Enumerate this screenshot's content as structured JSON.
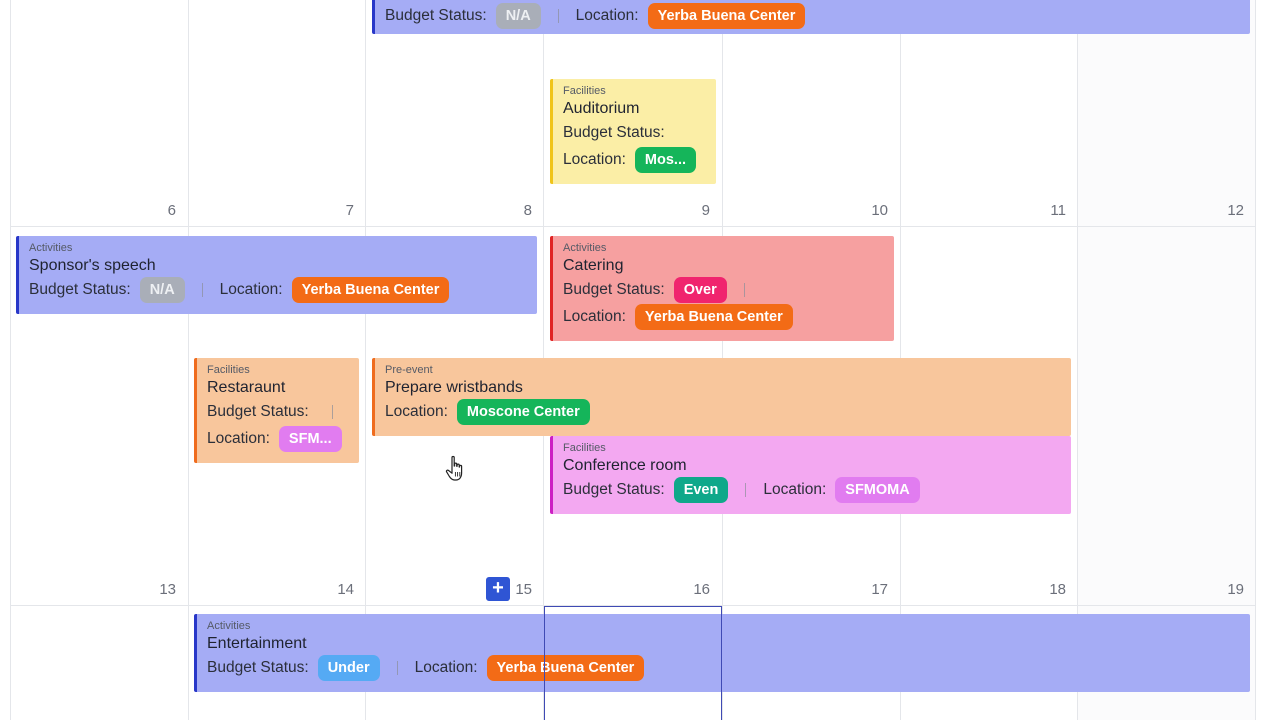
{
  "days": {
    "week1": [
      "6",
      "7",
      "8",
      "9",
      "10",
      "11",
      "12"
    ],
    "week2": [
      "13",
      "14",
      "15",
      "16",
      "17",
      "18",
      "19"
    ]
  },
  "events": {
    "top_bar": {
      "budget_label": "Budget Status:",
      "budget": "N/A",
      "location_label": "Location:",
      "location": "Yerba Buena Center"
    },
    "auditorium": {
      "category": "Facilities",
      "title": "Auditorium",
      "budget_label": "Budget Status:",
      "location_label": "Location:",
      "location": "Mos..."
    },
    "sponsor": {
      "category": "Activities",
      "title": "Sponsor's speech",
      "budget_label": "Budget Status:",
      "budget": "N/A",
      "location_label": "Location:",
      "location": "Yerba Buena Center"
    },
    "catering": {
      "category": "Activities",
      "title": "Catering",
      "budget_label": "Budget Status:",
      "budget": "Over",
      "location_label": "Location:",
      "location": "Yerba Buena Center"
    },
    "restaurant": {
      "category": "Facilities",
      "title": "Restaraunt",
      "budget_label": "Budget Status:",
      "location_label": "Location:",
      "location": "SFM..."
    },
    "wristbands": {
      "category": "Pre-event",
      "title": "Prepare wristbands",
      "location_label": "Location:",
      "location": "Moscone Center"
    },
    "conference": {
      "category": "Facilities",
      "title": "Conference room",
      "budget_label": "Budget Status:",
      "budget": "Even",
      "location_label": "Location:",
      "location": "SFMOMA"
    },
    "entertainment": {
      "category": "Activities",
      "title": "Entertainment",
      "budget_label": "Budget Status:",
      "budget": "Under",
      "location_label": "Location:",
      "location": "Yerba Buena Center"
    }
  },
  "add_button_label": "+",
  "colors": {
    "activities": "#a5acf5",
    "facilities_yellow": "#fbeea6",
    "catering_red": "#f6a0a0",
    "pre_event": "#f8c69c",
    "facilities_pink": "#f3a8f1",
    "accent": "#2f55d4"
  },
  "icons": {
    "add": "plus-icon",
    "cursor": "hand-pointer-icon"
  }
}
